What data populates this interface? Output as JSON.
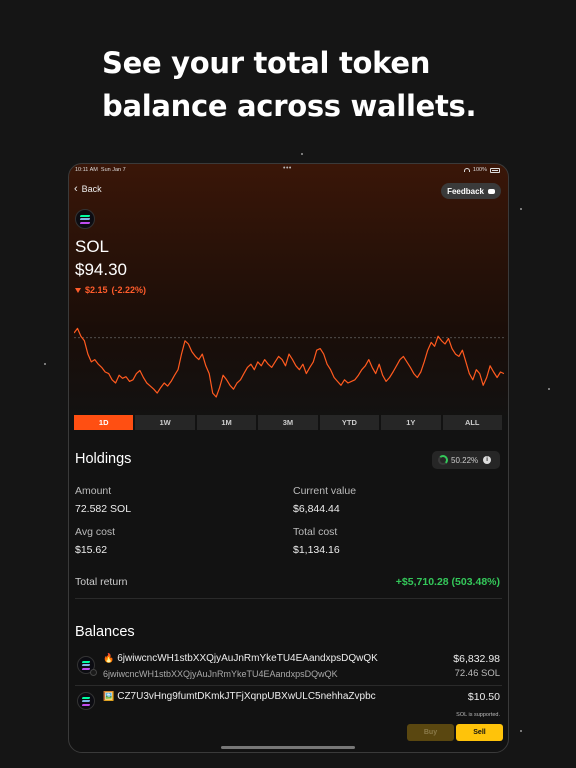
{
  "headline": {
    "line1": "See your total token",
    "line2": "balance across wallets."
  },
  "status_bar": {
    "time": "10:11 AM",
    "date": "Sun Jan 7",
    "dots": "•••",
    "battery": "100%"
  },
  "nav": {
    "back_label": "Back",
    "feedback_label": "Feedback"
  },
  "coin": {
    "symbol": "SOL",
    "price": "$94.30",
    "change_abs": "$2.15",
    "change_pct": "(-2.22%)",
    "icon": "solana-logo-icon"
  },
  "chart_data": {
    "type": "line",
    "series": [
      {
        "values": [
          0.82,
          0.88,
          0.78,
          0.72,
          0.55,
          0.45,
          0.48,
          0.42,
          0.38,
          0.32,
          0.3,
          0.22,
          0.18,
          0.28,
          0.24,
          0.26,
          0.2,
          0.22,
          0.3,
          0.34,
          0.25,
          0.18,
          0.14,
          0.1,
          0.05,
          0.12,
          0.18,
          0.14,
          0.2,
          0.28,
          0.35,
          0.55,
          0.72,
          0.68,
          0.58,
          0.52,
          0.48,
          0.55,
          0.4,
          0.3,
          0.05,
          0.0,
          0.12,
          0.28,
          0.22,
          0.15,
          0.1,
          0.18,
          0.22,
          0.3,
          0.38,
          0.42,
          0.35,
          0.45,
          0.4,
          0.48,
          0.42,
          0.38,
          0.45,
          0.52,
          0.48,
          0.4,
          0.55,
          0.48,
          0.4,
          0.35,
          0.42,
          0.3,
          0.38,
          0.45,
          0.6,
          0.62,
          0.55,
          0.42,
          0.35,
          0.25,
          0.2,
          0.15,
          0.22,
          0.18,
          0.2,
          0.22,
          0.28,
          0.35,
          0.4,
          0.48,
          0.38,
          0.3,
          0.42,
          0.28,
          0.2,
          0.25,
          0.32,
          0.4,
          0.48,
          0.52,
          0.45,
          0.38,
          0.3,
          0.25,
          0.32,
          0.45,
          0.6,
          0.7,
          0.65,
          0.78,
          0.72,
          0.68,
          0.75,
          0.62,
          0.55,
          0.52,
          0.6,
          0.45,
          0.3,
          0.22,
          0.35,
          0.3,
          0.15,
          0.25,
          0.4,
          0.32,
          0.25,
          0.32,
          0.3
        ]
      }
    ],
    "reference_value": 0.76,
    "ylim": [
      0,
      1
    ],
    "line_color": "#ff5a1f",
    "ranges": [
      "1D",
      "1W",
      "1M",
      "3M",
      "YTD",
      "1Y",
      "ALL"
    ],
    "active_range": "1D"
  },
  "holdings": {
    "title": "Holdings",
    "percent": "50.22%",
    "amount_label": "Amount",
    "amount_value": "72.582 SOL",
    "current_value_label": "Current value",
    "current_value": "$6,844.44",
    "avg_cost_label": "Avg cost",
    "avg_cost_value": "$15.62",
    "total_cost_label": "Total cost",
    "total_cost_value": "$1,134.16",
    "total_return_label": "Total return",
    "total_return_value": "+$5,710.28 (503.48%)"
  },
  "balances": {
    "title": "Balances",
    "wallets": [
      {
        "emoji": "🔥",
        "name": "6jwiwcncWH1stbXXQjyAuJnRmYkeTU4EAandxpsDQwQK",
        "address": "6jwiwcncWH1stbXXQjyAuJnRmYkeTU4EAandxpsDQwQK",
        "value": "$6,832.98",
        "amount": "72.46 SOL"
      },
      {
        "emoji": "🖼️",
        "name": "CZ7U3vHng9fumtDKmkJTFjXqnpUBXwULC5nehhaZvpbc",
        "value": "$10.50"
      }
    ]
  },
  "footer": {
    "supported_text": "SOL is supported.",
    "buy_label": "Buy",
    "sell_label": "Sell"
  },
  "colors": {
    "accent": "#ff4f12",
    "positive": "#34c85a",
    "negative": "#ff5c2b",
    "sell": "#ffc30a"
  }
}
